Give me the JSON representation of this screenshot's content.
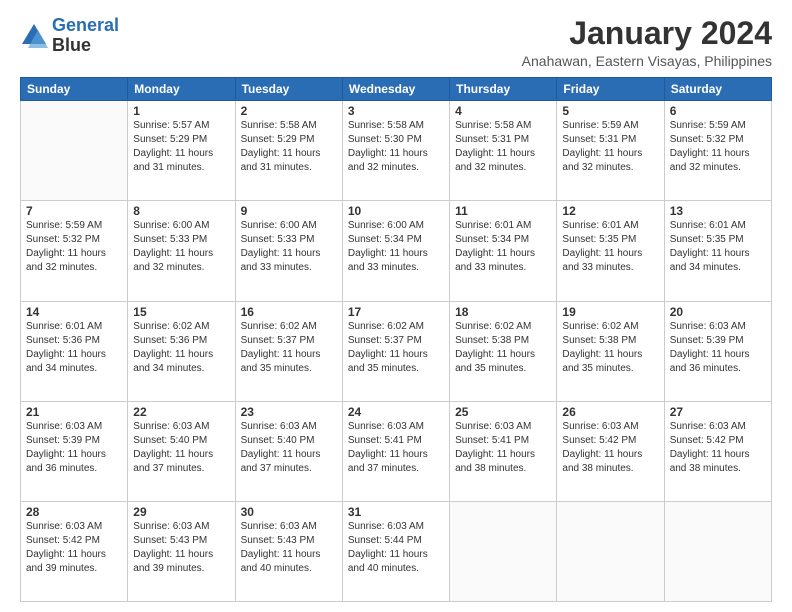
{
  "header": {
    "logo_line1": "General",
    "logo_line2": "Blue",
    "title": "January 2024",
    "subtitle": "Anahawan, Eastern Visayas, Philippines"
  },
  "columns": [
    "Sunday",
    "Monday",
    "Tuesday",
    "Wednesday",
    "Thursday",
    "Friday",
    "Saturday"
  ],
  "rows": [
    [
      {
        "day": "",
        "info": ""
      },
      {
        "day": "1",
        "info": "Sunrise: 5:57 AM\nSunset: 5:29 PM\nDaylight: 11 hours\nand 31 minutes."
      },
      {
        "day": "2",
        "info": "Sunrise: 5:58 AM\nSunset: 5:29 PM\nDaylight: 11 hours\nand 31 minutes."
      },
      {
        "day": "3",
        "info": "Sunrise: 5:58 AM\nSunset: 5:30 PM\nDaylight: 11 hours\nand 32 minutes."
      },
      {
        "day": "4",
        "info": "Sunrise: 5:58 AM\nSunset: 5:31 PM\nDaylight: 11 hours\nand 32 minutes."
      },
      {
        "day": "5",
        "info": "Sunrise: 5:59 AM\nSunset: 5:31 PM\nDaylight: 11 hours\nand 32 minutes."
      },
      {
        "day": "6",
        "info": "Sunrise: 5:59 AM\nSunset: 5:32 PM\nDaylight: 11 hours\nand 32 minutes."
      }
    ],
    [
      {
        "day": "7",
        "info": "Sunrise: 5:59 AM\nSunset: 5:32 PM\nDaylight: 11 hours\nand 32 minutes."
      },
      {
        "day": "8",
        "info": "Sunrise: 6:00 AM\nSunset: 5:33 PM\nDaylight: 11 hours\nand 32 minutes."
      },
      {
        "day": "9",
        "info": "Sunrise: 6:00 AM\nSunset: 5:33 PM\nDaylight: 11 hours\nand 33 minutes."
      },
      {
        "day": "10",
        "info": "Sunrise: 6:00 AM\nSunset: 5:34 PM\nDaylight: 11 hours\nand 33 minutes."
      },
      {
        "day": "11",
        "info": "Sunrise: 6:01 AM\nSunset: 5:34 PM\nDaylight: 11 hours\nand 33 minutes."
      },
      {
        "day": "12",
        "info": "Sunrise: 6:01 AM\nSunset: 5:35 PM\nDaylight: 11 hours\nand 33 minutes."
      },
      {
        "day": "13",
        "info": "Sunrise: 6:01 AM\nSunset: 5:35 PM\nDaylight: 11 hours\nand 34 minutes."
      }
    ],
    [
      {
        "day": "14",
        "info": "Sunrise: 6:01 AM\nSunset: 5:36 PM\nDaylight: 11 hours\nand 34 minutes."
      },
      {
        "day": "15",
        "info": "Sunrise: 6:02 AM\nSunset: 5:36 PM\nDaylight: 11 hours\nand 34 minutes."
      },
      {
        "day": "16",
        "info": "Sunrise: 6:02 AM\nSunset: 5:37 PM\nDaylight: 11 hours\nand 35 minutes."
      },
      {
        "day": "17",
        "info": "Sunrise: 6:02 AM\nSunset: 5:37 PM\nDaylight: 11 hours\nand 35 minutes."
      },
      {
        "day": "18",
        "info": "Sunrise: 6:02 AM\nSunset: 5:38 PM\nDaylight: 11 hours\nand 35 minutes."
      },
      {
        "day": "19",
        "info": "Sunrise: 6:02 AM\nSunset: 5:38 PM\nDaylight: 11 hours\nand 35 minutes."
      },
      {
        "day": "20",
        "info": "Sunrise: 6:03 AM\nSunset: 5:39 PM\nDaylight: 11 hours\nand 36 minutes."
      }
    ],
    [
      {
        "day": "21",
        "info": "Sunrise: 6:03 AM\nSunset: 5:39 PM\nDaylight: 11 hours\nand 36 minutes."
      },
      {
        "day": "22",
        "info": "Sunrise: 6:03 AM\nSunset: 5:40 PM\nDaylight: 11 hours\nand 37 minutes."
      },
      {
        "day": "23",
        "info": "Sunrise: 6:03 AM\nSunset: 5:40 PM\nDaylight: 11 hours\nand 37 minutes."
      },
      {
        "day": "24",
        "info": "Sunrise: 6:03 AM\nSunset: 5:41 PM\nDaylight: 11 hours\nand 37 minutes."
      },
      {
        "day": "25",
        "info": "Sunrise: 6:03 AM\nSunset: 5:41 PM\nDaylight: 11 hours\nand 38 minutes."
      },
      {
        "day": "26",
        "info": "Sunrise: 6:03 AM\nSunset: 5:42 PM\nDaylight: 11 hours\nand 38 minutes."
      },
      {
        "day": "27",
        "info": "Sunrise: 6:03 AM\nSunset: 5:42 PM\nDaylight: 11 hours\nand 38 minutes."
      }
    ],
    [
      {
        "day": "28",
        "info": "Sunrise: 6:03 AM\nSunset: 5:42 PM\nDaylight: 11 hours\nand 39 minutes."
      },
      {
        "day": "29",
        "info": "Sunrise: 6:03 AM\nSunset: 5:43 PM\nDaylight: 11 hours\nand 39 minutes."
      },
      {
        "day": "30",
        "info": "Sunrise: 6:03 AM\nSunset: 5:43 PM\nDaylight: 11 hours\nand 40 minutes."
      },
      {
        "day": "31",
        "info": "Sunrise: 6:03 AM\nSunset: 5:44 PM\nDaylight: 11 hours\nand 40 minutes."
      },
      {
        "day": "",
        "info": ""
      },
      {
        "day": "",
        "info": ""
      },
      {
        "day": "",
        "info": ""
      }
    ]
  ]
}
